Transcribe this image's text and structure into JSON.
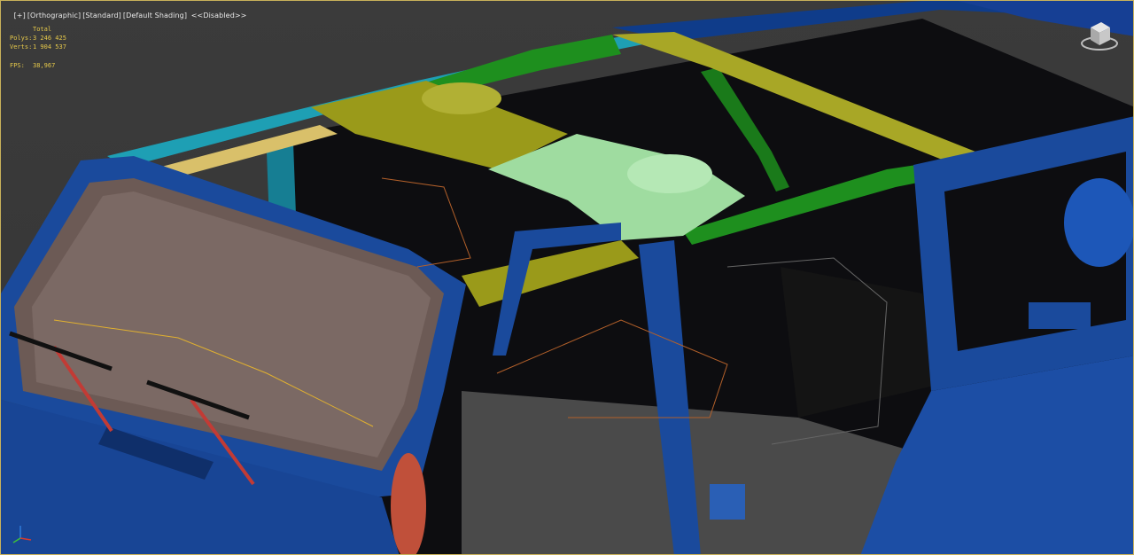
{
  "viewport": {
    "labels": [
      "[+]",
      "[Orthographic]",
      "[Standard]",
      "[Default Shading]",
      "<<Disabled>>"
    ]
  },
  "stats": {
    "header": "Total",
    "polys_label": "Polys:",
    "polys_value": "3 246 425",
    "verts_label": "Verts:",
    "verts_value": "1 904 537",
    "fps_label": "FPS:",
    "fps_value": "38,967"
  },
  "colors": {
    "background": "#3a3a3a",
    "body_blue": "#1a4a9c",
    "roll_bar_green": "#1e8f1e",
    "olive_panel": "#9a9a1a",
    "mint_panel": "#9fdca0",
    "teal_trim": "#1e9fb4",
    "tan_rail": "#d9c06a",
    "wiper_red": "#c23b35",
    "viewport_border": "#c9b25a",
    "stats_text": "#e5c84a"
  },
  "icons": {
    "viewcube": "viewcube-icon",
    "axis": "axis-tripod-icon"
  }
}
